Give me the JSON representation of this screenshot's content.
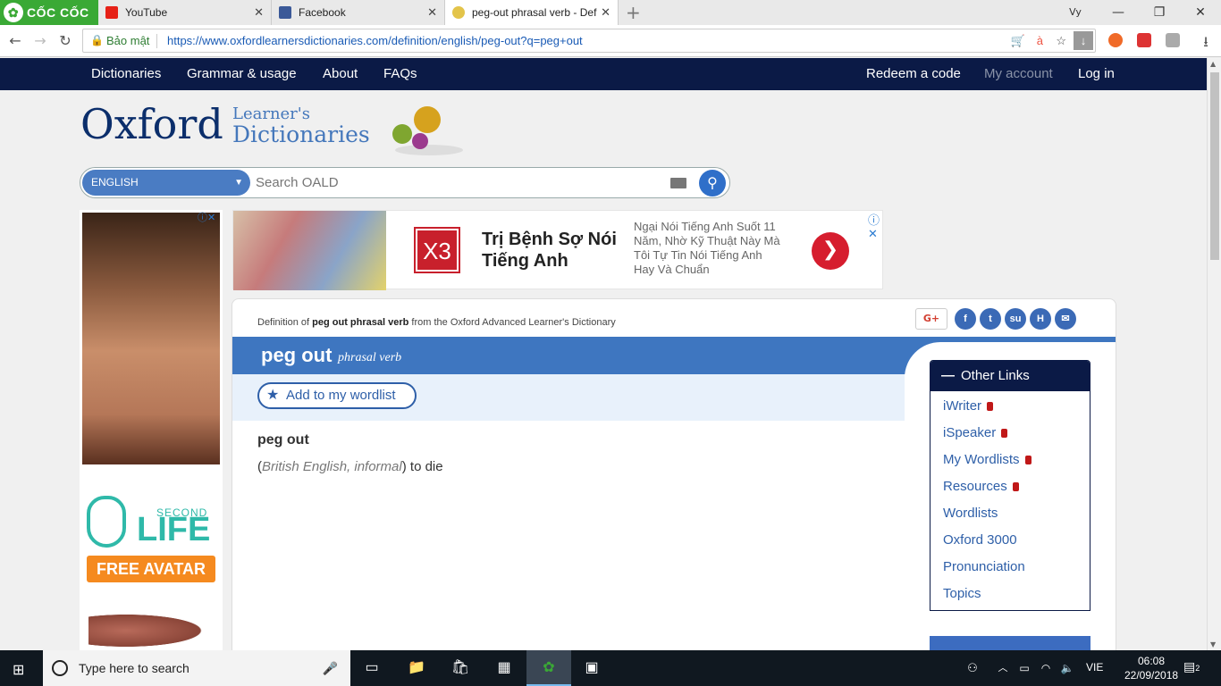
{
  "browser": {
    "brand": "CỐC CỐC",
    "tabs": [
      {
        "title": "YouTube",
        "icon": "youtube-icon",
        "color": "#e62117"
      },
      {
        "title": "Facebook",
        "icon": "facebook-icon",
        "color": "#3b5998"
      },
      {
        "title": "peg-out phrasal verb - Def",
        "icon": "oxford-icon",
        "color": "#e3c44a"
      }
    ],
    "secure_label": "Bảo mật",
    "url": "https://www.oxfordlearnersdictionaries.com/definition/english/peg-out?q=peg+out"
  },
  "sitenav": {
    "left": [
      "Dictionaries",
      "Grammar & usage",
      "About",
      "FAQs"
    ],
    "right": [
      "Redeem a code",
      "My account",
      "Log in"
    ]
  },
  "brand": {
    "oxford": "Oxford",
    "learners": "Learner's",
    "dictionaries": "Dictionaries"
  },
  "search": {
    "language": "ENGLISH",
    "placeholder": "Search OALD"
  },
  "ad_left": {
    "brand_second": "SECOND",
    "brand_life": "LIFE",
    "cta": "FREE AVATAR"
  },
  "ad_top": {
    "badge": "X3",
    "title": "Trị Bệnh Sợ Nói Tiếng Anh",
    "desc": "Ngại Nói Tiếng Anh Suốt 11 Năm, Nhờ Kỹ Thuật Này Mà Tôi Tự Tin Nói Tiếng Anh Hay Và Chuẩn"
  },
  "entry": {
    "definition_of_prefix": "Definition of ",
    "definition_of_term": "peg out phrasal verb",
    "definition_of_suffix": " from the Oxford Advanced Learner's Dictionary",
    "headword": "peg out",
    "pos": "phrasal verb",
    "wordlist_label": "Add to my wordlist",
    "sub_headword": "peg out",
    "label_open": "(",
    "label": "British English, informal",
    "label_close": ")",
    "definition": " to die"
  },
  "sidebar": {
    "title": "Other Links",
    "links": [
      {
        "label": "iWriter",
        "locked": true
      },
      {
        "label": "iSpeaker",
        "locked": true
      },
      {
        "label": "My Wordlists",
        "locked": true
      },
      {
        "label": "Resources",
        "locked": true
      },
      {
        "label": "Wordlists",
        "locked": false
      },
      {
        "label": "Oxford 3000",
        "locked": false
      },
      {
        "label": "Pronunciation",
        "locked": false
      },
      {
        "label": "Topics",
        "locked": false
      }
    ]
  },
  "taskbar": {
    "search_placeholder": "Type here to search",
    "lang": "VIE",
    "time": "06:08",
    "date": "22/09/2018",
    "notifications": "2"
  }
}
